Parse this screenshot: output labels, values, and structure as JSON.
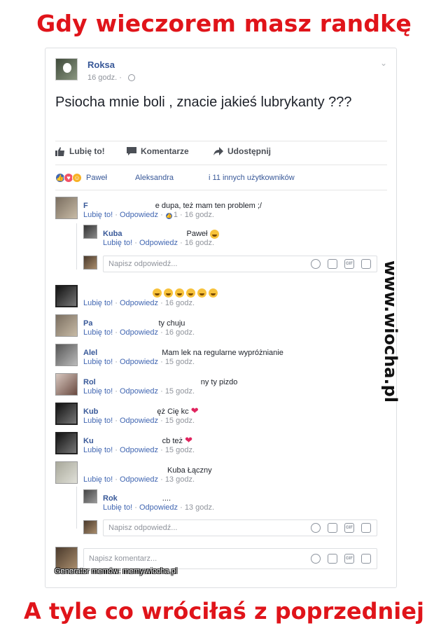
{
  "meme": {
    "top_caption": "Gdy wieczorem masz randkę",
    "bottom_caption": "A tyle co wróciłaś z poprzedniej",
    "side_watermark": "www.wiocha.pl",
    "generator": "Generator memów:  memy.wiocha.pl"
  },
  "post": {
    "author": "Roksa",
    "time": "16 godz. ·",
    "text": "Psiocha mnie boli , znacie jakieś lubrykanty ???",
    "actions": {
      "like": "Lubię to!",
      "comment": "Komentarze",
      "share": "Udostępnij"
    },
    "reactions_summary": {
      "name1": "Paweł",
      "name2": "Aleksandra",
      "rest": "i 11 innych użytkowników"
    }
  },
  "labels": {
    "like": "Lubię to!",
    "reply": "Odpowiedz",
    "reply_placeholder": "Napisz odpowiedź...",
    "comment_placeholder": "Napisz komentarz..."
  },
  "comments": [
    {
      "name": "F",
      "text": "e dupa, też mam ten problem ;/",
      "meta_likes": "1",
      "time": "16 godz."
    },
    {
      "name": "Kuba",
      "text": "Paweł",
      "time": "16 godz.",
      "reply": true
    },
    {
      "name": "",
      "text": "",
      "time": "16 godz."
    },
    {
      "name": "Pa",
      "text": "ty chuju",
      "time": "16 godz."
    },
    {
      "name": "Alel",
      "text": "Mam lek na regularne wypróżnianie",
      "time": "15 godz."
    },
    {
      "name": "Rol",
      "text": "ny ty pizdo",
      "time": "15 godz."
    },
    {
      "name": "Kub",
      "text": "ęż Cię kc",
      "time": "15 godz."
    },
    {
      "name": "Ku",
      "text": "cb też",
      "time": "15 godz."
    },
    {
      "name": "",
      "text": "Kuba Łączny",
      "time": "13 godz."
    },
    {
      "name": "Rok",
      "text": "....",
      "time": "13 godz.",
      "reply": true
    }
  ],
  "icons": {
    "gif": "GIF"
  }
}
